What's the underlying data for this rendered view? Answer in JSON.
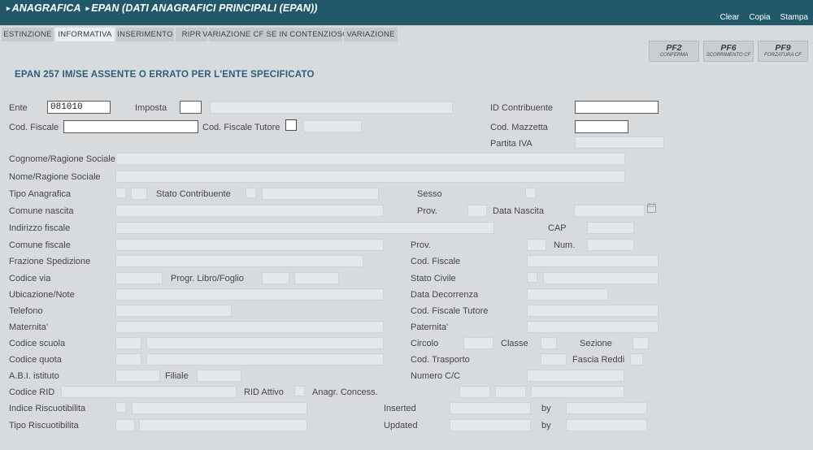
{
  "header": {
    "breadcrumb_root": "ANAGRAFICA",
    "breadcrumb_leaf": "EPAN (DATI ANAGRAFICI PRINCIPALI (EPAN))",
    "actions": [
      {
        "label": "Clear",
        "name": "clear-action"
      },
      {
        "label": "Copia",
        "name": "copia-action"
      },
      {
        "label": "Stampa",
        "name": "stampa-action"
      }
    ],
    "bg_color": "#21596b"
  },
  "tabs": [
    {
      "label": "ESTINZIONE",
      "active": false
    },
    {
      "label": "INFORMATIVA",
      "active": true
    },
    {
      "label": "INSERIMENTO",
      "active": false
    },
    {
      "label": "RIPR",
      "active": false
    },
    {
      "label": "VARIAZIONE CF SE IN CONTENZIOSO",
      "active": false
    },
    {
      "label": "VARIAZIONE",
      "active": false
    }
  ],
  "function_keys": [
    {
      "key": "PF2",
      "sub": "CONFERMA"
    },
    {
      "key": "PF6",
      "sub": "SCORRIMENTO CF"
    },
    {
      "key": "PF9",
      "sub": "FORZATURA CF"
    }
  ],
  "message": "EPAN 257 IM/SE ASSENTE O ERRATO PER L'ENTE SPECIFICATO",
  "form": {
    "labels": {
      "ente": "Ente",
      "imposta": "Imposta",
      "id_contribuente": "ID Contribuente",
      "cod_fiscale": "Cod. Fiscale",
      "cod_fiscale_tutore": "Cod. Fiscale Tutore",
      "cod_mazzetta": "Cod. Mazzetta",
      "partita_iva": "Partita IVA",
      "cognome_ragione_sociale": "Cognome/Ragione Sociale",
      "nome_ragione_sociale": "Nome/Ragione Sociale",
      "tipo_anagrafica": "Tipo Anagrafica",
      "stato_contribuente": "Stato Contribuente",
      "sesso": "Sesso",
      "comune_nascita": "Comune nascita",
      "prov_nascita": "Prov.",
      "data_nascita": "Data Nascita",
      "indirizzo_fiscale": "Indirizzo fiscale",
      "cap": "CAP",
      "comune_fiscale": "Comune fiscale",
      "prov_fiscale": "Prov.",
      "num": "Num.",
      "frazione_spedizione": "Frazione Spedizione",
      "cod_fiscale_2": "Cod. Fiscale",
      "codice_via": "Codice via",
      "progr_libro_foglio": "Progr. Libro/Foglio",
      "stato_civile": "Stato Civile",
      "ubicazione_note": "Ubicazione/Note",
      "data_decorrenza": "Data Decorrenza",
      "telefono": "Telefono",
      "cod_fiscale_tutore_2": "Cod. Fiscale Tutore",
      "maternita": "Maternita'",
      "paternita": "Paternita'",
      "codice_scuola": "Codice scuola",
      "circolo": "Circolo",
      "classe": "Classe",
      "sezione": "Sezione",
      "codice_quota": "Codice quota",
      "cod_trasporto": "Cod. Trasporto",
      "fascia_reddi": "Fascia Reddi",
      "abi_istituto": "A.B.I. istituto",
      "filiale": "Filiale",
      "numero_cc": "Numero C/C",
      "codice_rid": "Codice RID",
      "rid_attivo": "RID Attivo",
      "anagr_concess": "Anagr. Concess.",
      "indice_riscuotibilita": "Indice Riscuotibilita",
      "inserted": "Inserted",
      "by_1": "by",
      "tipo_riscuotibilita": "Tipo Riscuotibilita",
      "updated": "Updated",
      "by_2": "by"
    },
    "values": {
      "ente": "081010",
      "imposta": "",
      "id_contribuente": "",
      "cod_fiscale": "",
      "cod_fiscale_tutore": "",
      "cod_mazzetta": "",
      "partita_iva": "",
      "cognome_ragione_sociale": "",
      "nome_ragione_sociale": "",
      "tipo_anagrafica": "",
      "stato_contribuente": "",
      "comune_nascita": "",
      "data_nascita": "",
      "indirizzo_fiscale": "",
      "cap": "",
      "comune_fiscale": "",
      "num": "",
      "frazione_spedizione": "",
      "cod_fiscale_2": "",
      "codice_via": "",
      "stato_civile": "",
      "ubicazione_note": "",
      "data_decorrenza": "",
      "telefono": "",
      "cod_fiscale_tutore_2": "",
      "maternita": "",
      "paternita": "",
      "codice_scuola": "",
      "circolo": "",
      "codice_quota": "",
      "abi_istituto": "",
      "filiale": "",
      "numero_cc": "",
      "codice_rid": "",
      "indice_riscuotibilita": "",
      "inserted_date": "",
      "inserted_by": "",
      "tipo_riscuotibilita": "",
      "updated_date": "",
      "updated_by": ""
    }
  },
  "icons": {
    "calendar": "calendar-icon"
  },
  "colors": {
    "header_bg": "#21596b",
    "page_bg": "#d7dbdd",
    "message_text": "#2a5f7a",
    "tab_bg": "#c3c9cd",
    "tab_active_bg": "#eceef0",
    "field_bg": "#e3e8ea",
    "field_border": "#ccd2d5",
    "editable_bg": "#ffffff",
    "editable_border": "#5a5a5a",
    "label_text": "#4a4050"
  }
}
